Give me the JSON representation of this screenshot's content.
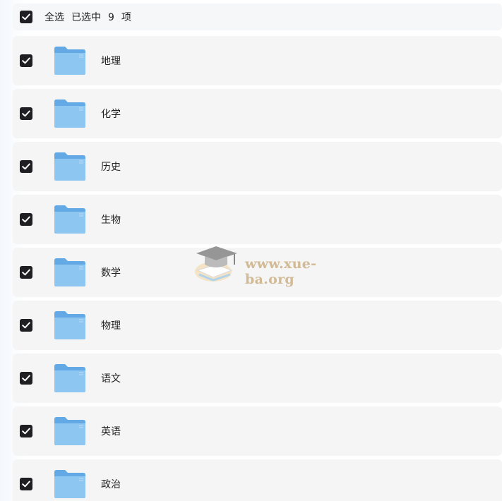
{
  "header": {
    "select_all_label": "全选",
    "selected_prefix": "已选中",
    "selected_count": "9",
    "selected_suffix": "项"
  },
  "items": [
    {
      "label": "地理",
      "checked": true
    },
    {
      "label": "化学",
      "checked": true
    },
    {
      "label": "历史",
      "checked": true
    },
    {
      "label": "生物",
      "checked": true
    },
    {
      "label": "数学",
      "checked": true
    },
    {
      "label": "物理",
      "checked": true
    },
    {
      "label": "语文",
      "checked": true
    },
    {
      "label": "英语",
      "checked": true
    },
    {
      "label": "政治",
      "checked": true
    }
  ],
  "watermark": {
    "text": "www.xue-ba.org"
  },
  "colors": {
    "checkbox": "#1f1f23",
    "folder_front": "#8ec6f2",
    "folder_back": "#63a9e6",
    "row_background": "#f5f5f6",
    "watermark": "#c8a877"
  },
  "icons": {
    "checkbox": "checkbox-checked-icon",
    "folder": "folder-icon",
    "watermark_logo": "graduation-cap-icon"
  }
}
